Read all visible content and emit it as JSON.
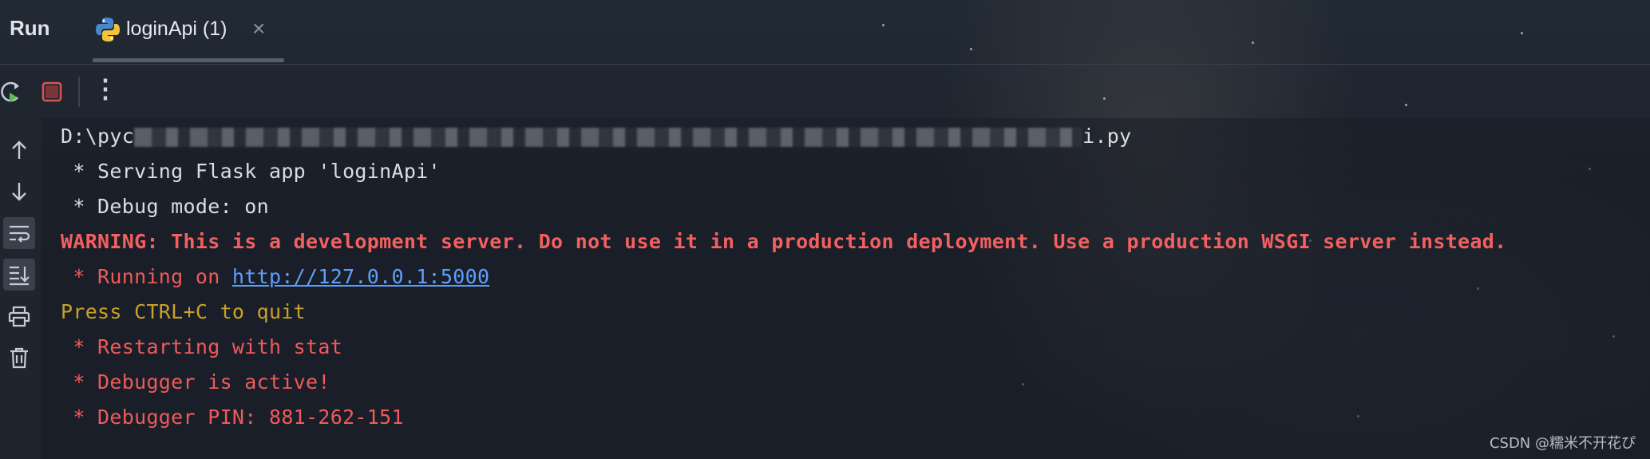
{
  "panel": {
    "title": "Run"
  },
  "tab": {
    "label": "loginApi (1)",
    "close": "×",
    "icon": "python-icon"
  },
  "toolbar": {
    "rerun": "rerun-icon",
    "stop": "stop-icon",
    "more": "⋮"
  },
  "gutter": [
    "up-arrow-icon",
    "down-arrow-icon",
    "soft-wrap-icon",
    "scroll-to-end-icon",
    "print-icon",
    "trash-icon"
  ],
  "console": {
    "line1_prefix": "D:\\pyc",
    "line1_suffix": "i.py",
    "line2": " * Serving Flask app 'loginApi'",
    "line3": " * Debug mode: on",
    "line4": "WARNING: This is a development server. Do not use it in a production deployment. Use a production WSGI server instead.",
    "line5_prefix": " * Running on ",
    "line5_link": "http://127.0.0.1:5000",
    "line6": "Press CTRL+C to quit",
    "line7": " * Restarting with stat",
    "line8": " * Debugger is active!",
    "line9": " * Debugger PIN: 881-262-151"
  },
  "watermark": "CSDN @糯米不开花ぴ",
  "colors": {
    "warning": "#f26060",
    "info_red": "#f05a5a",
    "link": "#5ca0ff",
    "quit": "#c9a227"
  }
}
